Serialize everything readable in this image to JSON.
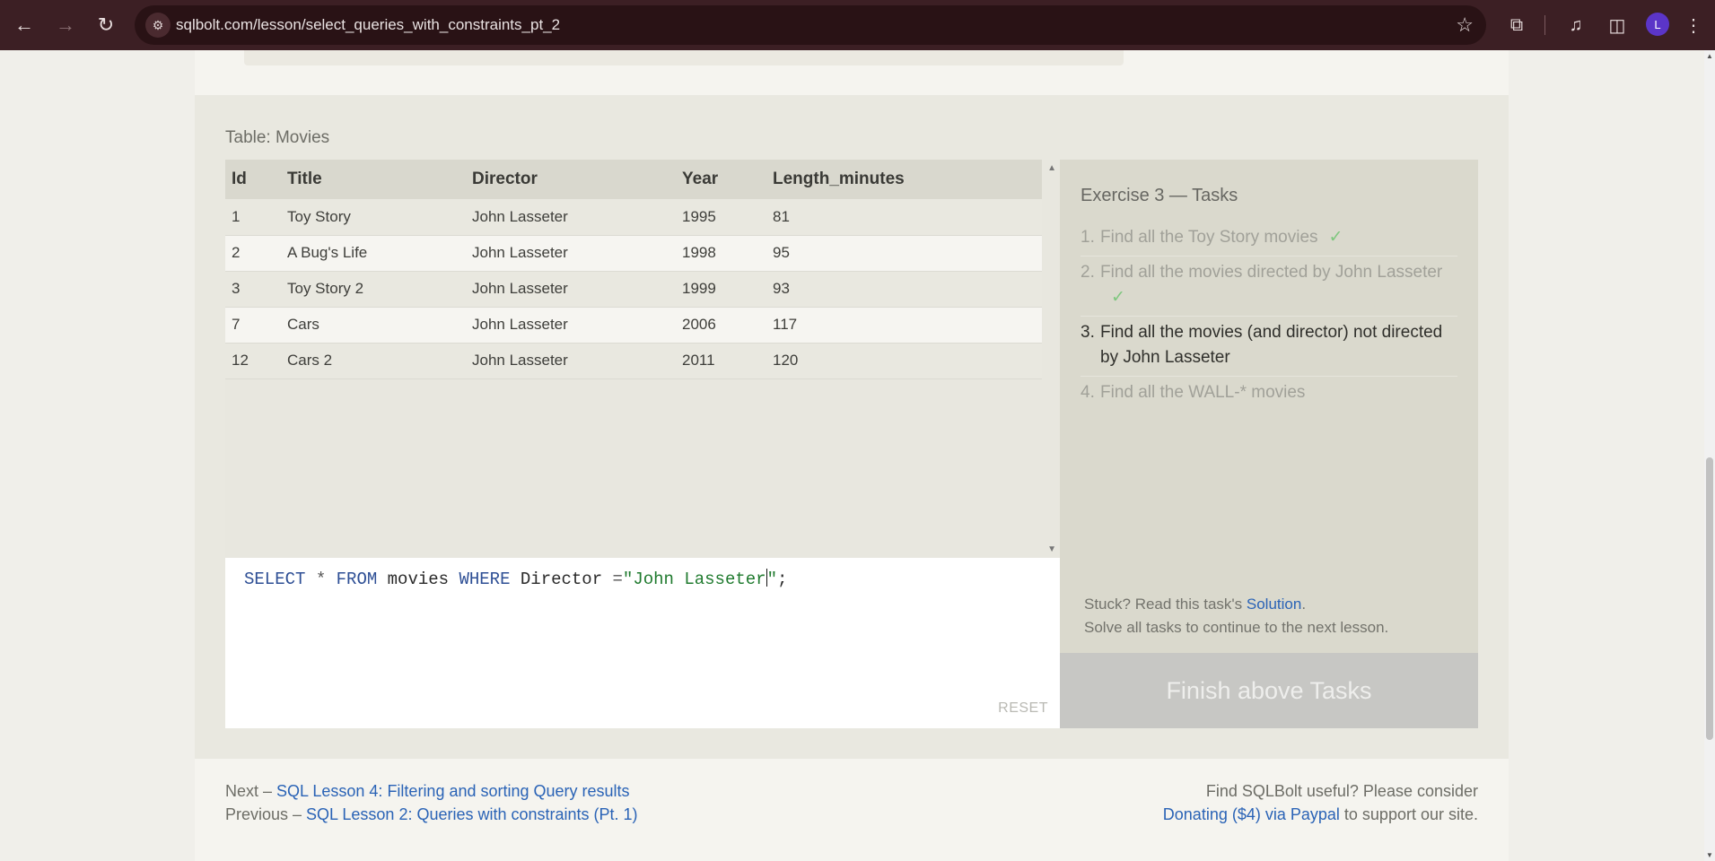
{
  "browser": {
    "url": "sqlbolt.com/lesson/select_queries_with_constraints_pt_2",
    "avatar_initial": "L",
    "icons": [
      "back-icon",
      "forward-icon",
      "reload-icon",
      "site-info-icon",
      "bookmark-star-icon",
      "extensions-icon",
      "media-icon",
      "side-panel-icon",
      "menu-icon"
    ]
  },
  "table": {
    "caption": "Table: Movies",
    "columns": [
      "Id",
      "Title",
      "Director",
      "Year",
      "Length_minutes"
    ],
    "rows": [
      [
        "1",
        "Toy Story",
        "John Lasseter",
        "1995",
        "81"
      ],
      [
        "2",
        "A Bug's Life",
        "John Lasseter",
        "1998",
        "95"
      ],
      [
        "3",
        "Toy Story 2",
        "John Lasseter",
        "1999",
        "93"
      ],
      [
        "7",
        "Cars",
        "John Lasseter",
        "2006",
        "117"
      ],
      [
        "12",
        "Cars 2",
        "John Lasseter",
        "2011",
        "120"
      ]
    ]
  },
  "editor": {
    "tokens": {
      "select": "SELECT",
      "star": " * ",
      "from": "FROM",
      "table": " movies ",
      "where": "WHERE",
      "column": " Director ",
      "eq": "=",
      "string_before_cursor": "\"John Lasseter",
      "string_after_cursor": "\"",
      "semicolon": ";"
    },
    "reset_label": "RESET"
  },
  "tasks": {
    "title": "Exercise 3 — Tasks",
    "items": [
      {
        "num": "1.",
        "text": "Find all the Toy Story movies",
        "check": "✓",
        "state": "done"
      },
      {
        "num": "2.",
        "text": "Find all the movies directed by John Lasseter",
        "check": "✓",
        "state": "done"
      },
      {
        "num": "3.",
        "text": "Find all the movies (and director) not directed by John Lasseter",
        "check": "",
        "state": "active"
      },
      {
        "num": "4.",
        "text": "Find all the WALL-* movies",
        "check": "",
        "state": "todo"
      }
    ],
    "stuck_prefix": "Stuck? Read this task's ",
    "solution_link": "Solution",
    "stuck_suffix": ".",
    "continue_text": "Solve all tasks to continue to the next lesson.",
    "finish_button": "Finish above Tasks"
  },
  "footer": {
    "next_prefix": "Next – ",
    "next_link": "SQL Lesson 4: Filtering and sorting Query results",
    "prev_prefix": "Previous – ",
    "prev_link": "SQL Lesson 2: Queries with constraints (Pt. 1)",
    "useful_text": "Find SQLBolt useful? Please consider",
    "donate_link": "Donating ($4) via Paypal",
    "donate_suffix": " to support our site."
  }
}
